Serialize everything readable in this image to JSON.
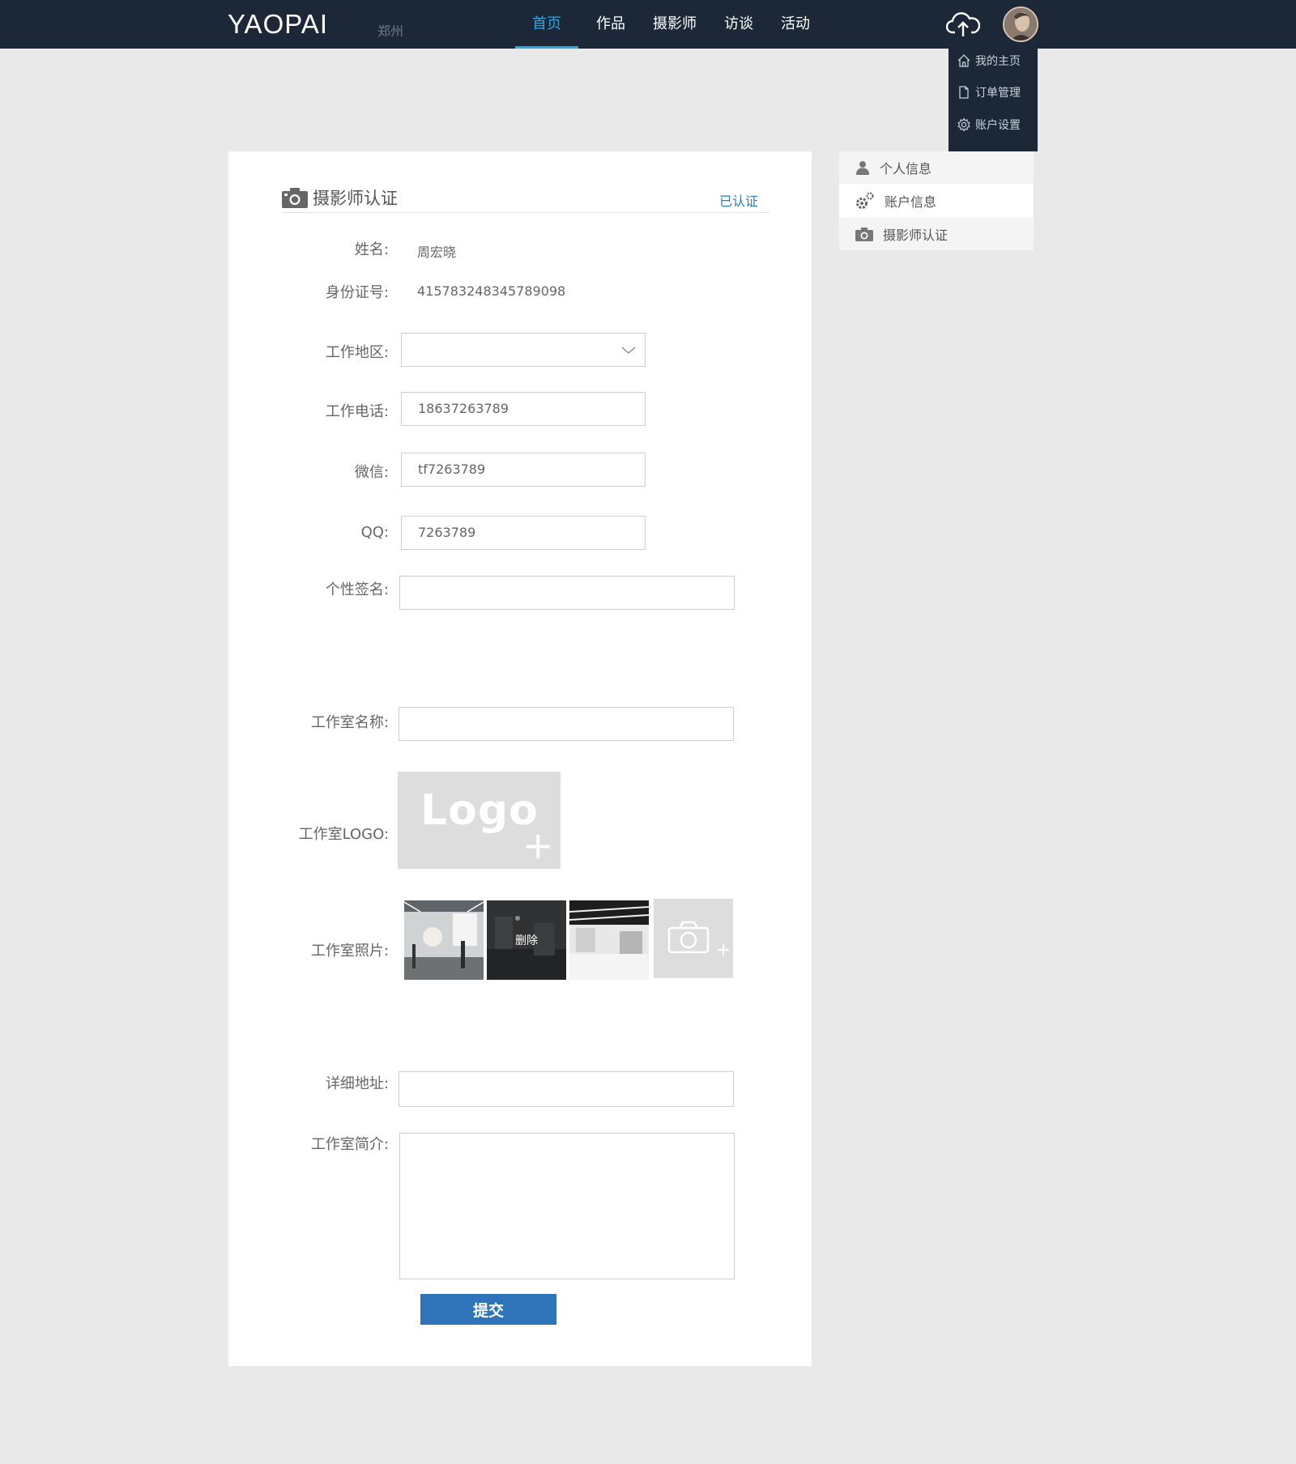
{
  "topbar": {
    "brand": "YAOPAI",
    "city": "郑州",
    "nav": [
      {
        "label": "首页",
        "active": true
      },
      {
        "label": "作品",
        "active": false
      },
      {
        "label": "摄影师",
        "active": false
      },
      {
        "label": "访谈",
        "active": false
      },
      {
        "label": "活动",
        "active": false
      }
    ],
    "accent": "#29a9df",
    "background": "#1c2838"
  },
  "dropdown": {
    "items": [
      {
        "label": "我的主页",
        "icon": "home-icon"
      },
      {
        "label": "订单管理",
        "icon": "document-icon"
      },
      {
        "label": "账户设置",
        "icon": "gear-icon"
      }
    ]
  },
  "card": {
    "title": "摄影师认证",
    "status": "已认证",
    "fields": {
      "name_label": "姓名:",
      "name_value": "周宏晓",
      "id_label": "身份证号:",
      "id_value": "415783248345789098",
      "region_label": "工作地区:",
      "region_value": "",
      "phone_label": "工作电话:",
      "phone_value": "18637263789",
      "wechat_label": "微信:",
      "wechat_value": "tf7263789",
      "qq_label": "QQ:",
      "qq_value": "7263789",
      "signature_label": "个性签名:",
      "signature_value": "",
      "studio_name_label": "工作室名称:",
      "studio_name_value": "",
      "studio_logo_label": "工作室LOGO:",
      "logo_placeholder": "Logo",
      "studio_photos_label": "工作室照片:",
      "photo_delete": "删除",
      "address_label": "详细地址:",
      "address_value": "",
      "intro_label": "工作室简介:",
      "intro_value": ""
    },
    "submit_label": "提交"
  },
  "sidebar": {
    "items": [
      {
        "label": "个人信息",
        "icon": "user-icon"
      },
      {
        "label": "账户信息",
        "icon": "gears-icon"
      },
      {
        "label": "摄影师认证",
        "icon": "camera-icon"
      }
    ]
  }
}
